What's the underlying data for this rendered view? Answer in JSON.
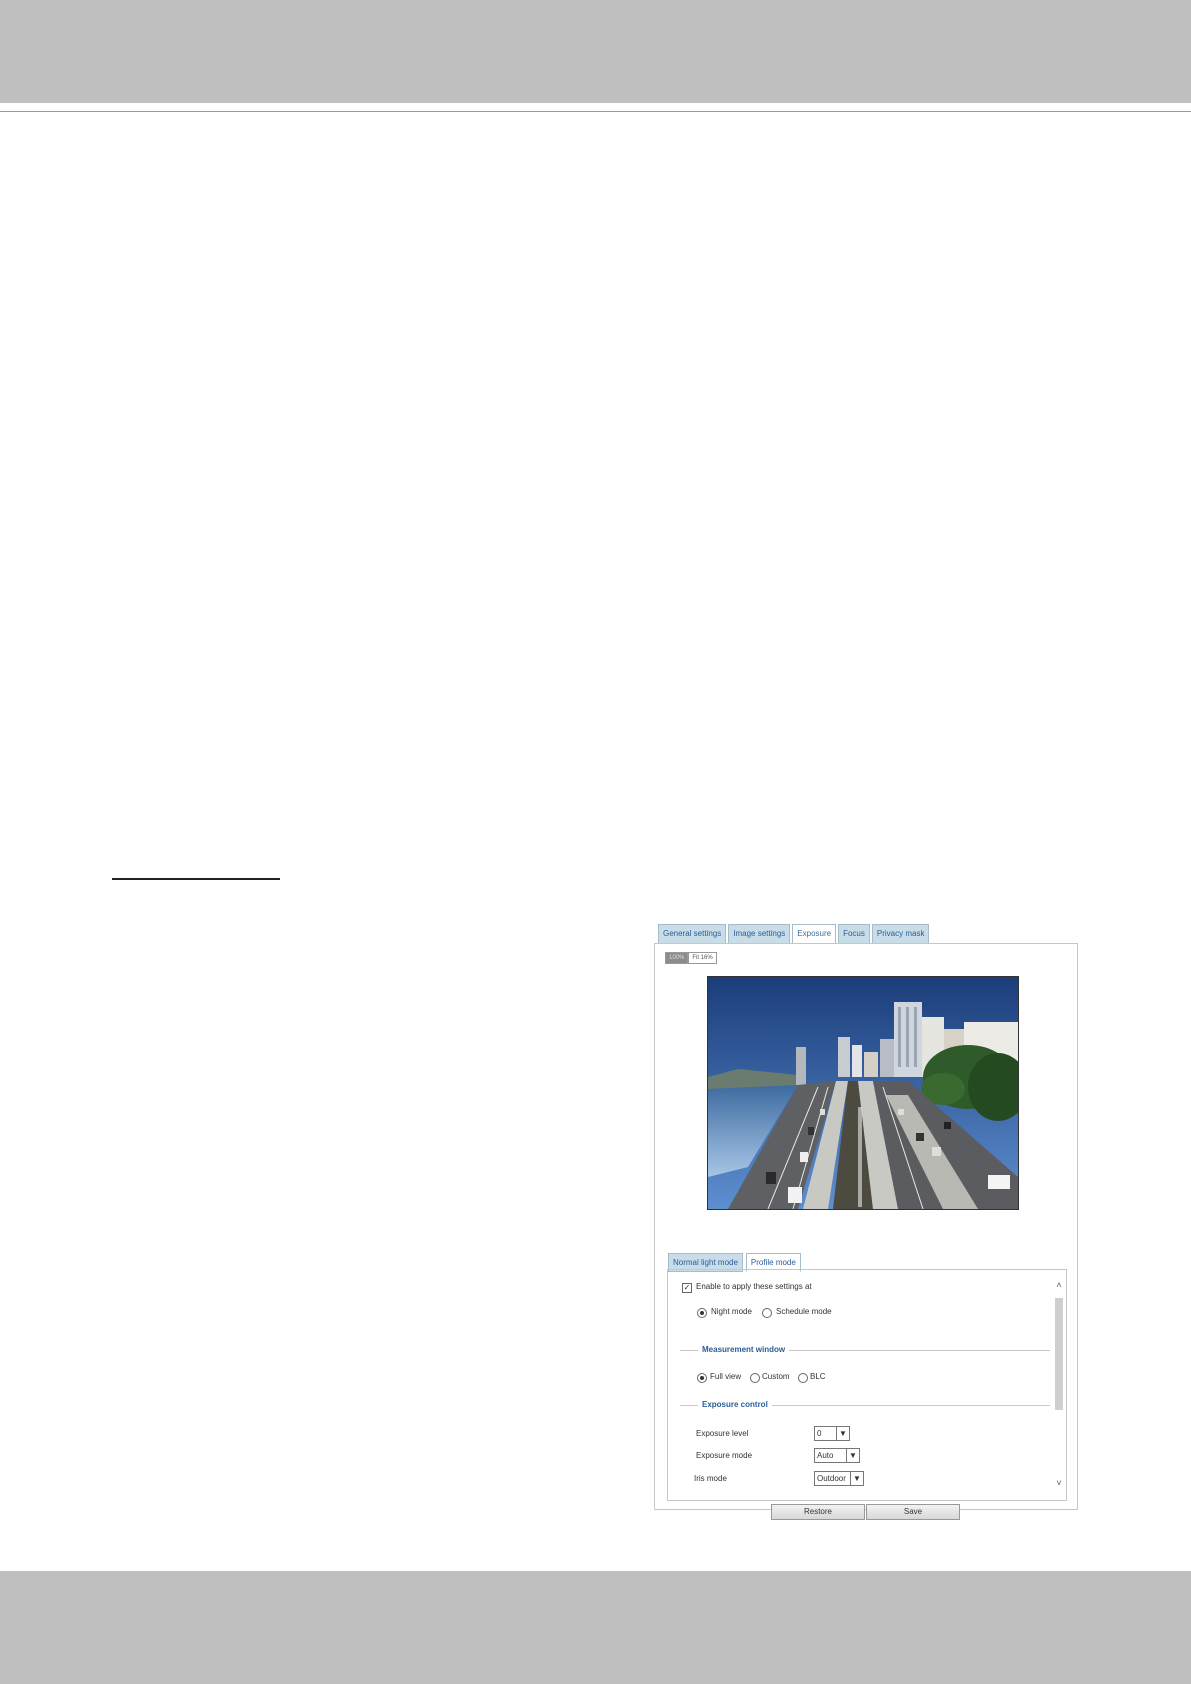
{
  "panel": {
    "tabs": [
      "General settings",
      "Image settings",
      "Exposure",
      "Focus",
      "Privacy mask"
    ],
    "active_tab": "Exposure",
    "zoom": [
      "100%",
      "Fit 16%"
    ],
    "sub_tabs": [
      "Normal light mode",
      "Profile mode"
    ],
    "active_sub_tab": "Profile mode",
    "enable_label": "Enable to apply these settings at",
    "enable_checked": true,
    "mode_options": [
      "Night mode",
      "Schedule mode"
    ],
    "mode_selected": "Night mode",
    "measurement_legend": "Measurement window",
    "measurement_options": [
      "Full view",
      "Custom",
      "BLC"
    ],
    "measurement_selected": "Full view",
    "exposure_legend": "Exposure control",
    "fields": [
      {
        "label": "Exposure level",
        "value": "0"
      },
      {
        "label": "Exposure mode",
        "value": "Auto"
      },
      {
        "label": "Iris mode",
        "value": "Outdoor"
      }
    ],
    "restore_label": "Restore",
    "save_label": "Save"
  }
}
